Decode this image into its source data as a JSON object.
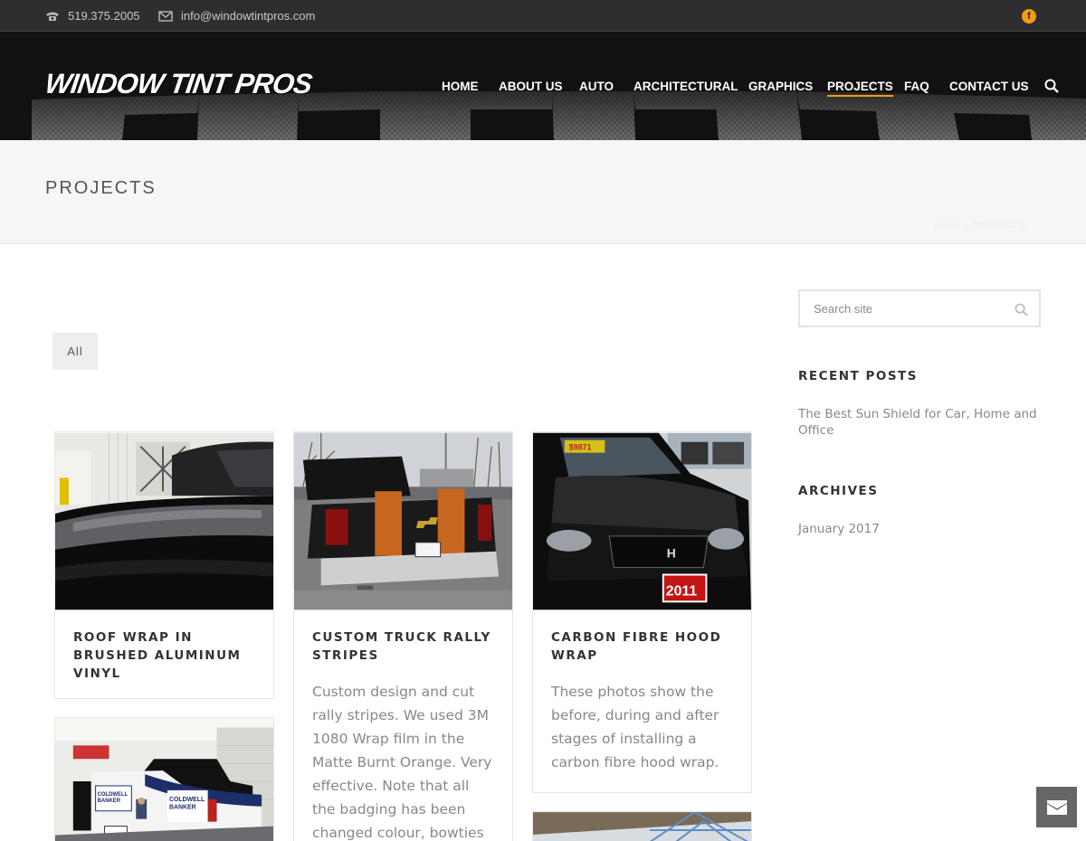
{
  "topbar": {
    "phone": "519.375.2005",
    "email": "info@windowtintpros.com",
    "facebook_label": "f"
  },
  "header": {
    "logo_text": "WINDOW TINT PROS",
    "nav": [
      {
        "label": "HOME"
      },
      {
        "label": "ABOUT US"
      },
      {
        "label": "AUTO"
      },
      {
        "label": "ARCHITECTURAL"
      },
      {
        "label": "GRAPHICS"
      },
      {
        "label": "PROJECTS",
        "active": true
      },
      {
        "label": "FAQ"
      },
      {
        "label": "CONTACT US"
      }
    ]
  },
  "titlebar": {
    "title": "PROJECTS",
    "breadcrumb_home": "Home",
    "breadcrumb_sep": "»",
    "breadcrumb_current": "PROJECTS"
  },
  "filter": {
    "all_label": "All"
  },
  "projects": [
    {
      "title": "ROOF WRAP IN BRUSHED ALUMINUM VINYL",
      "excerpt": ""
    },
    {
      "title": "CUSTOM TRUCK RALLY STRIPES",
      "excerpt": "Custom design and cut rally stripes.  We used 3M 1080 Wrap film in the Matte Burnt Orange.  Very effective.  Note that all the badging has been changed colour, bowties on the"
    },
    {
      "title": "CARBON FIBRE HOOD WRAP",
      "excerpt": "These photos show the before, during and after stages of installing a carbon fibre hood wrap."
    }
  ],
  "sidebar": {
    "search_placeholder": "Search site",
    "recent_posts_title": "RECENT POSTS",
    "recent_posts": [
      "The Best Sun Shield for Car, Home and Office"
    ],
    "archives_title": "ARCHIVES",
    "archives": [
      "January 2017"
    ]
  },
  "colors": {
    "accent": "#f39c12",
    "topbar_bg": "#2e2e31",
    "header_bg": "#111111",
    "title_bg": "#f6f6f6",
    "muted_text": "#888888"
  },
  "icons": {
    "phone": "phone-icon",
    "email": "envelope-icon",
    "facebook": "facebook-icon",
    "search": "search-icon",
    "contact_float": "envelope-icon"
  }
}
